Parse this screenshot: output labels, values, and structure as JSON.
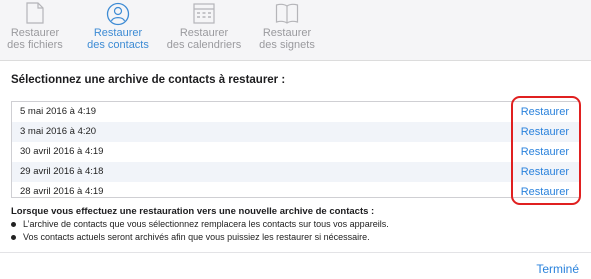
{
  "tabs": [
    {
      "line1": "Restaurer",
      "line2": "des fichiers",
      "icon": "document-icon",
      "active": false
    },
    {
      "line1": "Restaurer",
      "line2": "des contacts",
      "icon": "contact-icon",
      "active": true
    },
    {
      "line1": "Restaurer",
      "line2": "des calendriers",
      "icon": "calendar-icon",
      "active": false
    },
    {
      "line1": "Restaurer",
      "line2": "des signets",
      "icon": "book-icon",
      "active": false
    }
  ],
  "heading": "Sélectionnez une archive de contacts à restaurer :",
  "archives": [
    {
      "date": "5 mai 2016 à 4:19",
      "action": "Restaurer"
    },
    {
      "date": "3 mai 2016 à 4:20",
      "action": "Restaurer"
    },
    {
      "date": "30 avril 2016 à 4:19",
      "action": "Restaurer"
    },
    {
      "date": "29 avril 2016 à 4:18",
      "action": "Restaurer"
    },
    {
      "date": "28 avril 2016 à 4:19",
      "action": "Restaurer"
    }
  ],
  "info": {
    "title": "Lorsque vous effectuez une restauration vers une nouvelle archive de contacts :",
    "bullets": [
      "L’archive de contacts que vous sélectionnez remplacera les contacts sur tous vos appareils.",
      "Vos contacts actuels seront archivés afin que vous puissiez les restaurer si nécessaire."
    ]
  },
  "done_label": "Terminé",
  "colors": {
    "accent": "#2a82dc",
    "highlight": "#e02020"
  }
}
